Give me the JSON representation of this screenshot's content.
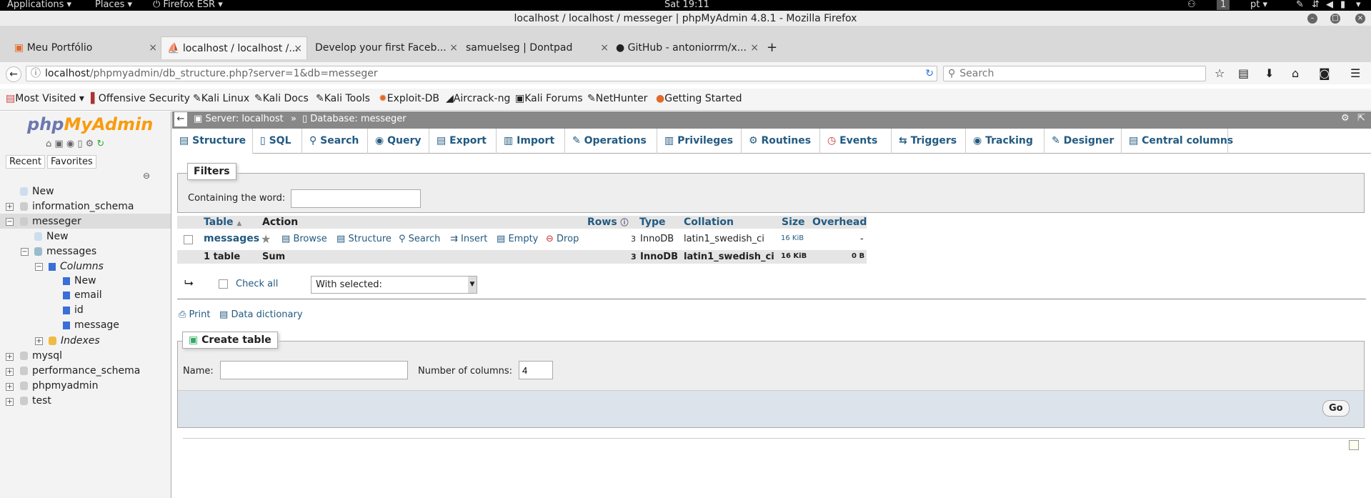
{
  "os": {
    "apps": "Applications",
    "places": "Places",
    "firefox": "Firefox ESR",
    "clock": "Sat 19:11",
    "workspace": "1",
    "lang": "pt"
  },
  "window": {
    "title": "localhost / localhost / messeger | phpMyAdmin 4.8.1 - Mozilla Firefox"
  },
  "tabs": [
    {
      "label": "Meu Portfólio"
    },
    {
      "label": "localhost / localhost /..."
    },
    {
      "label": "Develop your first Faceb..."
    },
    {
      "label": "samuelseg | Dontpad"
    },
    {
      "label": "GitHub - antoniorrm/x..."
    }
  ],
  "nav": {
    "url_host": "localhost",
    "url_path": "/phpmyadmin/db_structure.php?server=1&db=messeger",
    "search_placeholder": "Search"
  },
  "bookmarks": [
    "Most Visited",
    "Offensive Security",
    "Kali Linux",
    "Kali Docs",
    "Kali Tools",
    "Exploit-DB",
    "Aircrack-ng",
    "Kali Forums",
    "NetHunter",
    "Getting Started"
  ],
  "pma": {
    "logo_php": "php",
    "logo_myadmin": "MyAdmin",
    "recent": "Recent",
    "favorites": "Favorites",
    "tree": {
      "new": "New",
      "information_schema": "information_schema",
      "messeger": "messeger",
      "messeger_new": "New",
      "messages": "messages",
      "columns": "Columns",
      "col_new": "New",
      "email": "email",
      "id": "id",
      "message": "message",
      "indexes": "Indexes",
      "mysql": "mysql",
      "performance_schema": "performance_schema",
      "phpmyadmin": "phpmyadmin",
      "test": "test"
    },
    "breadcrumb": {
      "server": "Server: localhost",
      "sep": "»",
      "database": "Database: messeger"
    },
    "menu": [
      "Structure",
      "SQL",
      "Search",
      "Query",
      "Export",
      "Import",
      "Operations",
      "Privileges",
      "Routines",
      "Events",
      "Triggers",
      "Tracking",
      "Designer",
      "Central columns"
    ],
    "filters": {
      "legend": "Filters",
      "label": "Containing the word:",
      "value": ""
    },
    "table": {
      "headers": {
        "table": "Table",
        "action": "Action",
        "rows": "Rows",
        "type": "Type",
        "collation": "Collation",
        "size": "Size",
        "overhead": "Overhead"
      },
      "row": {
        "name": "messages",
        "browse": "Browse",
        "structure": "Structure",
        "search": "Search",
        "insert": "Insert",
        "empty": "Empty",
        "drop": "Drop",
        "rows": "3",
        "type": "InnoDB",
        "collation": "latin1_swedish_ci",
        "size": "16",
        "size_unit": "KiB",
        "overhead": "-"
      },
      "sum": {
        "tables": "1 table",
        "label": "Sum",
        "rows": "3",
        "type": "InnoDB",
        "collation": "latin1_swedish_ci",
        "size": "16",
        "size_unit": "KiB",
        "overhead": "0",
        "overhead_unit": "B"
      }
    },
    "check_all": "Check all",
    "with_selected": "With selected:",
    "print": "Print",
    "data_dictionary": "Data dictionary",
    "create": {
      "legend": "Create table",
      "name_label": "Name:",
      "name_value": "",
      "num_label": "Number of columns:",
      "num_value": "4",
      "go": "Go"
    }
  }
}
